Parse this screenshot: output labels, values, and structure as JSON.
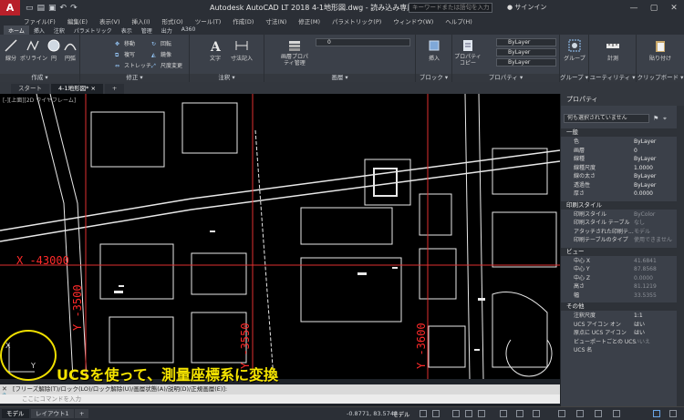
{
  "app": {
    "logo": "A",
    "title": "Autodesk AutoCAD LT 2018    4-1地形図.dwg - 読み込み専用",
    "search_placeholder": "キーワードまたは語句を入力",
    "signin": "サインイン"
  },
  "menu": [
    "ファイル(F)",
    "編集(E)",
    "表示(V)",
    "挿入(I)",
    "形式(O)",
    "ツール(T)",
    "作成(D)",
    "寸法(N)",
    "修正(M)",
    "パラメトリック(P)",
    "ウィンドウ(W)",
    "ヘルプ(H)"
  ],
  "ribbon_tabs": [
    "ホーム",
    "挿入",
    "注釈",
    "パラメトリック",
    "表示",
    "管理",
    "出力",
    "A360"
  ],
  "ribbon": {
    "draw": {
      "label": "作成",
      "line": "線分",
      "polyline": "ポリライン",
      "circle": "円",
      "arc": "円弧"
    },
    "modify": {
      "label": "修正",
      "move": "移動",
      "rotate": "回転",
      "copy": "複写",
      "mirror": "鏡像",
      "stretch": "ストレッチ",
      "scale": "尺度変更"
    },
    "annotation": {
      "label": "注釈",
      "text": "文字",
      "dimension": "寸法記入"
    },
    "layers": {
      "label": "画層",
      "layer_props": "画層プロパティ管理",
      "current_layer": "0"
    },
    "block": {
      "label": "ブロック",
      "insert": "挿入"
    },
    "properties": {
      "label": "プロパティ",
      "match": "プロパティ コピー",
      "color": "ByLayer",
      "linetype": "ByLayer",
      "lineweight": "ByLayer"
    },
    "groups": {
      "label": "グループ",
      "group": "グループ"
    },
    "utilities": {
      "label": "ユーティリティ",
      "measure": "計測"
    },
    "clipboard": {
      "label": "クリップボード",
      "paste": "貼り付け"
    }
  },
  "doc_tabs": [
    "スタート",
    "4-1地形図*"
  ],
  "viewport_control": "[-][上面][2D ワイヤフレーム]",
  "grid_labels": {
    "x": "X -43000",
    "y1": "Y -3500",
    "y2": "Y -3550",
    "y3": "Y -3600"
  },
  "callout": "UCSを使って、測量座標系に変換",
  "command": {
    "history": "[フリーズ解除(T)/ロック(LO)/ロック解除(U)/画層状態(A)/説明(D)/正規画層(E)]:",
    "prompt": "ここにコマンドを入力"
  },
  "status": {
    "model_tab": "モデル",
    "layout_tab": "レイアウト1",
    "coords": "-0.8771, 83.5743",
    "model_button": "モデル"
  },
  "properties_palette": {
    "title": "プロパティ",
    "selection": "何も選択されていません",
    "sections": [
      {
        "name": "一般",
        "rows": [
          {
            "k": "色",
            "v": "ByLayer"
          },
          {
            "k": "画層",
            "v": "0"
          },
          {
            "k": "線種",
            "v": "ByLayer"
          },
          {
            "k": "線種尺度",
            "v": "1.0000"
          },
          {
            "k": "線の太さ",
            "v": "ByLayer"
          },
          {
            "k": "透過性",
            "v": "ByLayer"
          },
          {
            "k": "厚さ",
            "v": "0.0000"
          }
        ]
      },
      {
        "name": "印刷スタイル",
        "rows": [
          {
            "k": "印刷スタイル",
            "v": "ByColor"
          },
          {
            "k": "印刷スタイル テーブル",
            "v": "なし"
          },
          {
            "k": "アタッチされた印刷テ...",
            "v": "モデル"
          },
          {
            "k": "印刷テーブルのタイプ",
            "v": "使用できません"
          }
        ]
      },
      {
        "name": "ビュー",
        "rows": [
          {
            "k": "中心 X",
            "v": "41.6841"
          },
          {
            "k": "中心 Y",
            "v": "87.8568"
          },
          {
            "k": "中心 Z",
            "v": "0.0000"
          },
          {
            "k": "高さ",
            "v": "81.1219"
          },
          {
            "k": "幅",
            "v": "33.5355"
          }
        ]
      },
      {
        "name": "その他",
        "rows": [
          {
            "k": "注釈尺度",
            "v": "1:1"
          },
          {
            "k": "UCS アイコン オン",
            "v": "はい"
          },
          {
            "k": "原点に UCS アイコン",
            "v": "はい"
          },
          {
            "k": "ビューポートごとの UCS",
            "v": "いいえ"
          },
          {
            "k": "UCS 名",
            "v": ""
          }
        ]
      }
    ]
  }
}
